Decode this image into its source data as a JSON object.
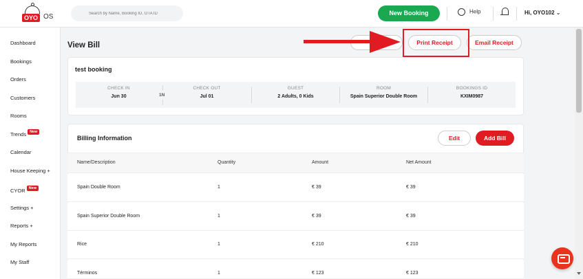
{
  "header": {
    "logo_text": "OYO",
    "logo_suffix": "OS",
    "search_placeholder": "Search by Name, Booking ID, OTA ID",
    "new_booking_label": "New Booking",
    "help_label": "Help",
    "user_label": "Hi, OYO102 ⌄"
  },
  "sidebar": {
    "items": [
      {
        "label": "Dashboard"
      },
      {
        "label": "Bookings"
      },
      {
        "label": "Orders"
      },
      {
        "label": "Customers"
      },
      {
        "label": "Rooms"
      },
      {
        "label": "Trends",
        "badge": "New"
      },
      {
        "label": "Calendar"
      },
      {
        "label": "House Keeping  +"
      },
      {
        "label": "CYOR",
        "badge": "New"
      },
      {
        "label": "Settings  +"
      },
      {
        "label": "Reports  +"
      },
      {
        "label": "My Reports"
      },
      {
        "label": "My Staff"
      }
    ]
  },
  "main": {
    "title": "View Bill",
    "print_receipt_label": "Print Receipt",
    "email_receipt_label": "Email Receipt",
    "booking_name": "test booking",
    "info": {
      "check_in_label": "CHECK IN",
      "check_in_value": "Jun 30",
      "nights": "1N",
      "check_out_label": "CHECK OUT",
      "check_out_value": "Jul 01",
      "guest_label": "GUEST",
      "guest_value": "2 Adults, 0 Kids",
      "room_label": "ROOM",
      "room_value": "Spain Superior Double Room",
      "booking_id_label": "BOOKINGS ID",
      "booking_id_value": "KXIM0987"
    },
    "billing": {
      "title": "Billing Information",
      "edit_label": "Edit",
      "add_bill_label": "Add Bill",
      "columns": [
        "Name/Description",
        "Quantity",
        "Amount",
        "Net Amount"
      ],
      "rows": [
        [
          "Spain Double Room",
          "1",
          "€ 39",
          "€ 39"
        ],
        [
          "Spain Superior Double Room",
          "1",
          "€ 39",
          "€ 39"
        ],
        [
          "Rice",
          "1",
          "€ 210",
          "€ 210"
        ],
        [
          "Términos",
          "1",
          "€ 123",
          "€ 123"
        ]
      ]
    }
  },
  "colors": {
    "brand_red": "#e01b22",
    "brand_green": "#1aa850"
  }
}
